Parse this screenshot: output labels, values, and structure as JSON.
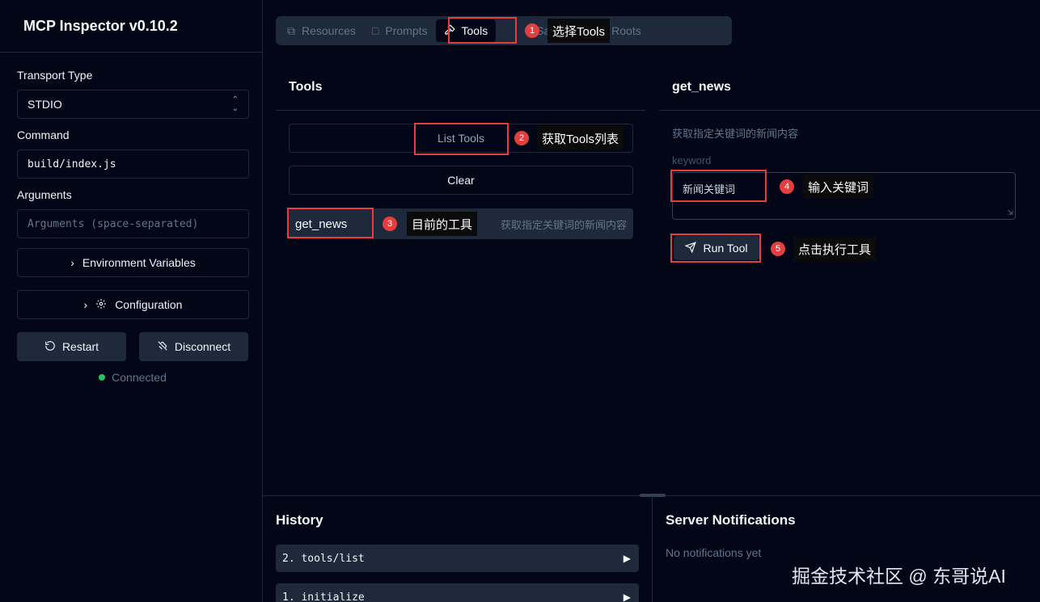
{
  "sidebar": {
    "title": "MCP Inspector v0.10.2",
    "transport_label": "Transport Type",
    "transport_value": "STDIO",
    "command_label": "Command",
    "command_value": "build/index.js",
    "arguments_label": "Arguments",
    "arguments_placeholder": "Arguments (space-separated)",
    "env_button": "Environment Variables",
    "config_button": "Configuration",
    "restart_button": "Restart",
    "disconnect_button": "Disconnect",
    "status": "Connected"
  },
  "tabs": [
    {
      "label": "Resources",
      "icon": "copy-icon"
    },
    {
      "label": "Prompts",
      "icon": "message-icon"
    },
    {
      "label": "Tools",
      "icon": "hammer-icon",
      "active": true
    },
    {
      "label": "Sampling",
      "icon": "sampling-icon"
    },
    {
      "label": "Roots",
      "icon": "roots-icon"
    }
  ],
  "tools_panel": {
    "title": "Tools",
    "list_button": "List Tools",
    "clear_button": "Clear",
    "items": [
      {
        "name": "get_news",
        "description": "获取指定关键词的新闻内容"
      }
    ]
  },
  "detail_panel": {
    "title": "get_news",
    "description": "获取指定关键词的新闻内容",
    "param_label": "keyword",
    "param_value": "新闻关键词",
    "run_button": "Run Tool"
  },
  "annotations": [
    {
      "number": "1",
      "text": "选择Tools"
    },
    {
      "number": "2",
      "text": "获取Tools列表"
    },
    {
      "number": "3",
      "text": "目前的工具"
    },
    {
      "number": "4",
      "text": "输入关键词"
    },
    {
      "number": "5",
      "text": "点击执行工具"
    }
  ],
  "history": {
    "title": "History",
    "items": [
      "2. tools/list",
      "1. initialize"
    ]
  },
  "notifications": {
    "title": "Server Notifications",
    "empty_text": "No notifications yet"
  },
  "watermark": "掘金技术社区 @ 东哥说AI",
  "colors": {
    "background": "#020617",
    "surface": "#1e293b",
    "annotation_red": "#e53e3e",
    "connected": "#22c55e"
  }
}
